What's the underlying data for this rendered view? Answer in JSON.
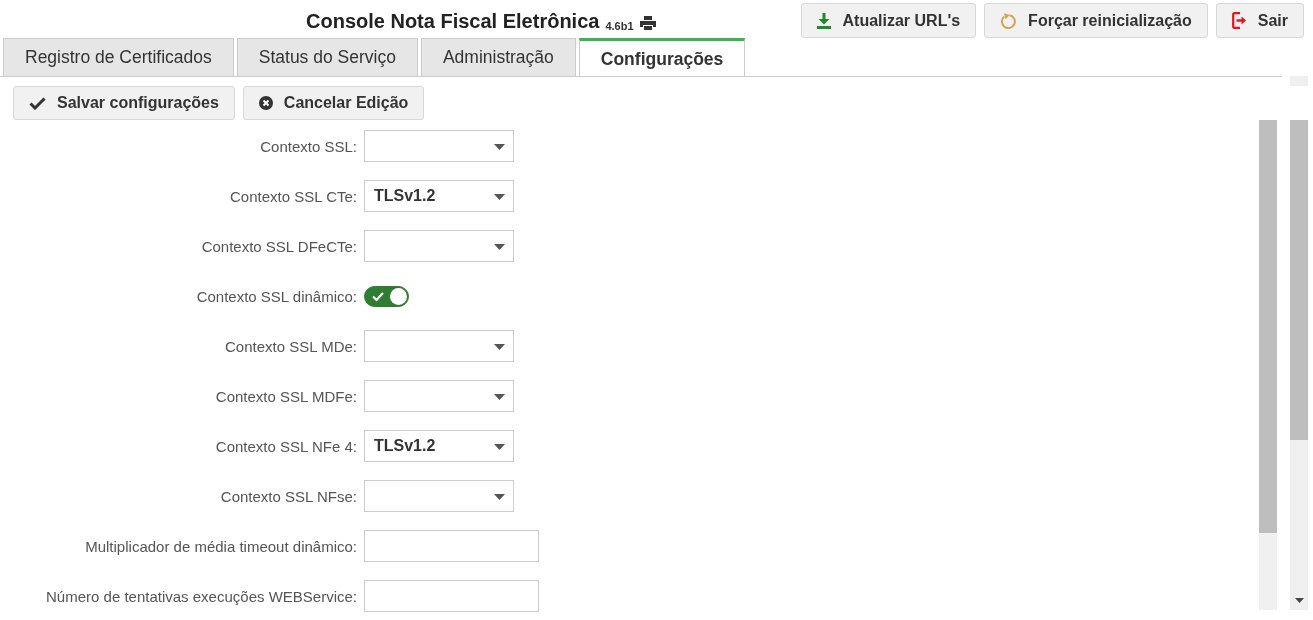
{
  "header": {
    "title": "Console Nota Fiscal Eletrônica",
    "version": "4.6b1"
  },
  "header_buttons": [
    {
      "label": "Atualizar URL's",
      "kind": "download"
    },
    {
      "label": "Forçar reinicialização",
      "kind": "restart"
    },
    {
      "label": "Sair",
      "kind": "exit"
    }
  ],
  "tabs": [
    {
      "label": "Registro de Certificados",
      "selected": false
    },
    {
      "label": "Status do Serviço",
      "selected": false
    },
    {
      "label": "Administração",
      "selected": false
    },
    {
      "label": "Configurações",
      "selected": true
    }
  ],
  "toolbar": [
    {
      "label": "Salvar configurações",
      "kind": "save"
    },
    {
      "label": "Cancelar Edição",
      "kind": "cancel"
    }
  ],
  "fields": [
    {
      "label": "Contexto SSL:",
      "kind": "select"
    },
    {
      "label": "Contexto SSL CTe:",
      "kind": "select",
      "value": "TLSv1.2"
    },
    {
      "label": "Contexto SSL DFeCTe:",
      "kind": "select"
    },
    {
      "label": "Contexto SSL dinâmico:",
      "kind": "toggle",
      "on": true
    },
    {
      "label": "Contexto SSL MDe:",
      "kind": "select"
    },
    {
      "label": "Contexto SSL MDFe:",
      "kind": "select"
    },
    {
      "label": "Contexto SSL NFe 4:",
      "kind": "select",
      "value": "TLSv1.2"
    },
    {
      "label": "Contexto SSL NFse:",
      "kind": "select"
    },
    {
      "label": "Multiplicador de média timeout dinâmico:",
      "kind": "text"
    },
    {
      "label": "Número de tentativas execuções WEBService:",
      "kind": "text"
    }
  ]
}
